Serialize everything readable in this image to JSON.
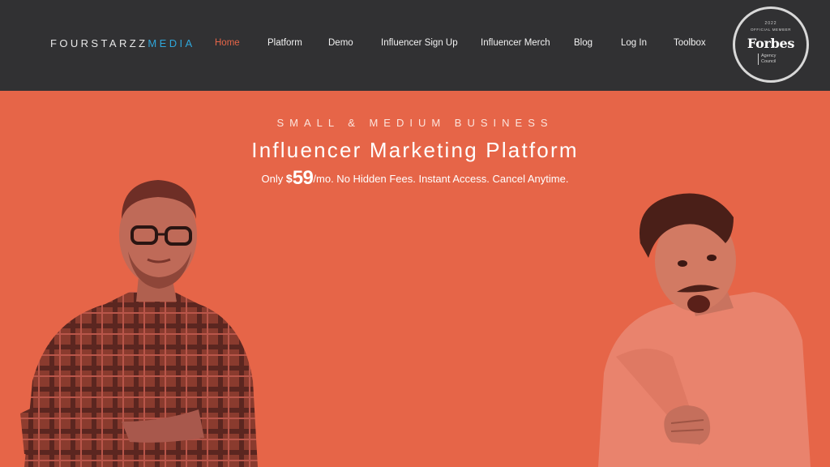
{
  "header": {
    "logo_primary": "FOURSTARZZ",
    "logo_accent": "MEDIA",
    "nav": [
      {
        "label": "Home",
        "active": true
      },
      {
        "label": "Platform"
      },
      {
        "label": "Demo"
      },
      {
        "label": "Influencer Sign Up"
      },
      {
        "label": "Influencer Merch"
      },
      {
        "label": "Blog"
      },
      {
        "label": "Log In"
      },
      {
        "label": "Toolbox"
      }
    ],
    "badge": {
      "year": "2022",
      "member": "OFFICIAL MEMBER",
      "brand": "Forbes",
      "council_line1": "Agency",
      "council_line2": "Council"
    }
  },
  "hero": {
    "kicker": "SMALL & MEDIUM BUSINESS",
    "headline": "Influencer Marketing Platform",
    "price_prefix": "Only",
    "price_currency": "$",
    "price_amount": "59",
    "price_rest": "/mo. No Hidden Fees. Instant Access. Cancel Anytime."
  },
  "colors": {
    "header_bg": "#313133",
    "hero_bg": "#E66548",
    "accent_blue": "#2FA6DA",
    "active_link": "#E66548"
  }
}
